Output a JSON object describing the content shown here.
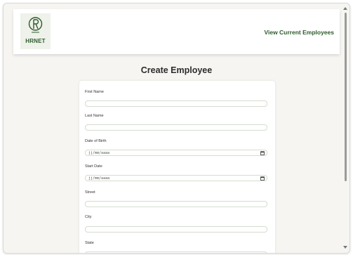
{
  "header": {
    "logo_text": "HRNET",
    "nav_link": "View Current Employees"
  },
  "page": {
    "title": "Create Employee"
  },
  "form": {
    "first_name_label": "First Name",
    "last_name_label": "Last Name",
    "dob_label": "Date of Birth",
    "dob_placeholder": "jj/mm/aaaa",
    "start_date_label": "Start Date",
    "start_date_placeholder": "jj/mm/aaaa",
    "street_label": "Street",
    "city_label": "City",
    "state_label": "State"
  },
  "colors": {
    "brand": "#2f5a2d",
    "background": "#f6f5f2",
    "field_border": "#d4ddcf"
  }
}
